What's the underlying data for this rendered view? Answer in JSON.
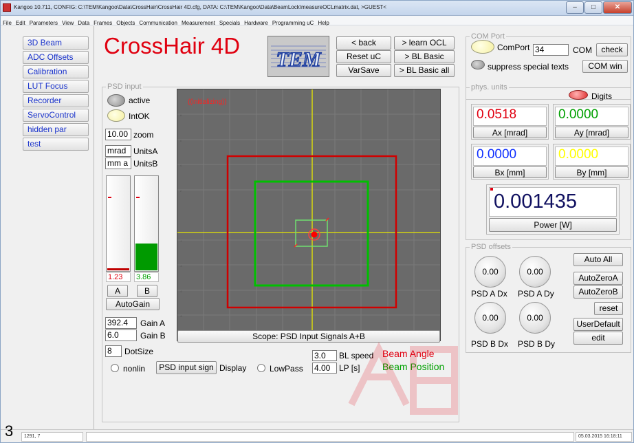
{
  "window": {
    "title": "Kangoo 10.711, CONFIG: C:\\TEM\\Kangoo\\Data\\CrossHair\\CrossHair 4D.cfg, DATA: C:\\TEM\\Kangoo\\Data\\BeamLock\\measureOCLmatrix.dat, >GUEST<",
    "minimize": "–",
    "maximize": "□",
    "close": "✕"
  },
  "menu": [
    "File",
    "Edit",
    "Parameters",
    "View",
    "Data",
    "Frames",
    "Objects",
    "Communication",
    "Measurement",
    "Specials",
    "Hardware",
    "Programming uC",
    "Help"
  ],
  "nav": [
    "3D Beam",
    "ADC Offsets",
    "Calibration",
    "LUT Focus",
    "Recorder",
    "ServoControl",
    "hidden par",
    "test"
  ],
  "app_title": "CrossHair 4D",
  "logo_text": "TEM",
  "toolbar": {
    "back": "< back",
    "learn_ocl": "> learn OCL",
    "reset_uc": "Reset uC",
    "bl_basic": "> BL Basic",
    "varsave": "VarSave",
    "bl_basic_all": "> BL Basic all"
  },
  "com_port": {
    "group_label": "COM Port",
    "comport_label": "ComPort",
    "port_value": "34",
    "com_label": "COM",
    "check": "check",
    "suppress": "suppress special texts",
    "com_win": "COM win"
  },
  "psd_input": {
    "group_label": "PSD input",
    "active": "active",
    "intok": "IntOK",
    "zoom_value": "10.00",
    "zoom_label": "zoom",
    "unitsA_value": "mrad",
    "unitsA_label": "UnitsA",
    "unitsB_value": "mm a",
    "unitsB_label": "UnitsB",
    "barA_value": "1.23",
    "barB_value": "3.86",
    "barA_level": 0.02,
    "barB_level": 0.29,
    "btnA": "A",
    "btnB": "B",
    "autogain": "AutoGain",
    "gainA_value": "392.4",
    "gainA_label": "Gain A",
    "gainB_value": "6.0",
    "gainB_label": "Gain B",
    "dotsize_value": "8",
    "dotsize_label": "DotSize"
  },
  "scope": {
    "status": "((initializing))",
    "button": "Scope: PSD Input Signals A+B"
  },
  "bottom": {
    "nonlin": "nonlin",
    "psd_input_sign": "PSD input sign",
    "display": "Display",
    "lowpass": "LowPass",
    "bl_speed_value": "3.0",
    "bl_speed_label": "BL speed",
    "lp_value": "4.00",
    "lp_label": "LP [s]",
    "beam_angle": "Beam Angle",
    "beam_position": "Beam Position"
  },
  "phys_units": {
    "group_label": "phys. units",
    "digits": "Digits",
    "ax_value": "0.0518",
    "ax_label": "Ax [mrad]",
    "ay_value": "0.0000",
    "ay_label": "Ay [mrad]",
    "bx_value": "0.0000",
    "bx_label": "Bx [mm]",
    "by_value": "0.0000",
    "by_label": "By [mm]",
    "power_value": "0.001435",
    "power_label": "Power [W]"
  },
  "psd_offsets": {
    "group_label": "PSD offsets",
    "knob_values": [
      "0.00",
      "0.00",
      "0.00",
      "0.00"
    ],
    "knob_labels": [
      "PSD A Dx",
      "PSD A Dy",
      "PSD B Dx",
      "PSD B Dy"
    ],
    "auto_all": "Auto All",
    "autozeroA": "AutoZeroA",
    "autozeroB": "AutoZeroB",
    "reset": "reset",
    "userdefault": "UserDefault",
    "edit": "edit"
  },
  "status": {
    "coords": "1291, 7",
    "datetime": "05.03.2015 16:18:11"
  },
  "overlay_digit": "3",
  "colors": {
    "accent_red": "#e00010",
    "beam_green": "#00a000",
    "nav_blue": "#1a33cc"
  }
}
